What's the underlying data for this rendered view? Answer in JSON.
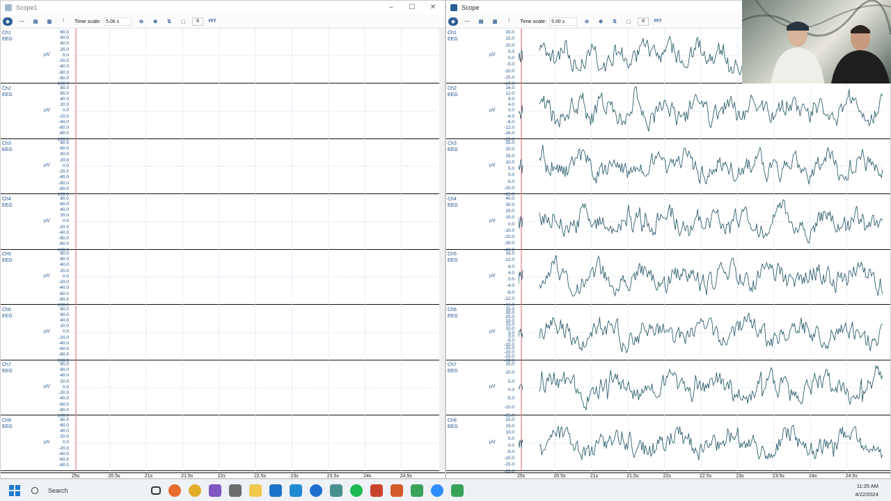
{
  "left_window": {
    "title": "Scope1",
    "toolbar": {
      "time_scale_label": "Time scale:",
      "time_scale_value": "5.00 s",
      "stepper_value": "8",
      "fft_label": "FFT"
    },
    "channels": [
      {
        "name": "Ch1",
        "type": "EEG",
        "unit": "µV",
        "ticks": [
          "80.0",
          "60.0",
          "40.0",
          "20.0",
          "0.0",
          "-20.0",
          "-40.0",
          "-60.0",
          "-80.0",
          "100.0"
        ]
      },
      {
        "name": "Ch2",
        "type": "EEG",
        "unit": "µV",
        "ticks": [
          "80.0",
          "60.0",
          "40.0",
          "20.0",
          "0.0",
          "-20.0",
          "-40.0",
          "-60.0",
          "-80.0",
          "100.0"
        ]
      },
      {
        "name": "Ch3",
        "type": "EEG",
        "unit": "µV",
        "ticks": [
          "80.0",
          "60.0",
          "40.0",
          "20.0",
          "0.0",
          "-20.0",
          "-40.0",
          "-60.0",
          "-80.0",
          "100.0"
        ]
      },
      {
        "name": "Ch4",
        "type": "EEG",
        "unit": "µV",
        "ticks": [
          "80.0",
          "60.0",
          "40.0",
          "20.0",
          "0.0",
          "-20.0",
          "-40.0",
          "-60.0",
          "-80.0",
          "100.0"
        ]
      },
      {
        "name": "Ch5",
        "type": "EEG",
        "unit": "µV",
        "ticks": [
          "80.0",
          "60.0",
          "40.0",
          "20.0",
          "0.0",
          "-20.0",
          "-40.0",
          "-60.0",
          "-80.0",
          "100.0"
        ]
      },
      {
        "name": "Ch6",
        "type": "EEG",
        "unit": "µV",
        "ticks": [
          "80.0",
          "60.0",
          "40.0",
          "20.0",
          "0.0",
          "-20.0",
          "-40.0",
          "-60.0",
          "-80.0",
          "100.0"
        ]
      },
      {
        "name": "Ch7",
        "type": "EEG",
        "unit": "µV",
        "ticks": [
          "80.0",
          "60.0",
          "40.0",
          "20.0",
          "0.0",
          "-20.0",
          "-40.0",
          "-60.0",
          "-80.0",
          "100.0"
        ]
      },
      {
        "name": "Ch8",
        "type": "EEG",
        "unit": "µV",
        "ticks": [
          "80.0",
          "60.0",
          "40.0",
          "20.0",
          "0.0",
          "-20.0",
          "-40.0",
          "-60.0",
          "-80.0",
          ""
        ]
      }
    ],
    "x_labels": [
      "25s",
      "20.5s",
      "21s",
      "21.5s",
      "22s",
      "22.5s",
      "23s",
      "23.5s",
      "24s",
      "24.5s"
    ]
  },
  "right_window": {
    "title": "Scope",
    "toolbar": {
      "time_scale_label": "Time scale:",
      "time_scale_value": "5.00 s",
      "stepper_value": "8",
      "fft_label": "FFT"
    },
    "channels": [
      {
        "name": "Ch1",
        "type": "EEG",
        "unit": "µV",
        "ticks": [
          "20.0",
          "15.0",
          "10.0",
          "5.0",
          "0.0",
          "-5.0",
          "-10.0",
          "-15.0",
          "-20.0"
        ]
      },
      {
        "name": "Ch2",
        "type": "EEG",
        "unit": "µV",
        "ticks": [
          "16.0",
          "12.0",
          "8.0",
          "4.0",
          "0.0",
          "-4.0",
          "-8.0",
          "-12.0",
          "-16.0",
          "-20.0"
        ]
      },
      {
        "name": "Ch3",
        "type": "EEG",
        "unit": "µV",
        "ticks": [
          "25.0",
          "20.0",
          "15.0",
          "10.0",
          "5.0",
          "0.0",
          "-5.0",
          "-10.0",
          "-15.0"
        ]
      },
      {
        "name": "Ch4",
        "type": "EEG",
        "unit": "µV",
        "ticks": [
          "40.0",
          "30.0",
          "20.0",
          "10.0",
          "0.0",
          "-10.0",
          "-20.0",
          "-30.0",
          "-40.0"
        ]
      },
      {
        "name": "Ch5",
        "type": "EEG",
        "unit": "µV",
        "ticks": [
          "16.0",
          "12.0",
          "8.0",
          "4.0",
          "0.0",
          "-4.0",
          "-8.0",
          "-12.0",
          "-16.0"
        ]
      },
      {
        "name": "Ch6",
        "type": "EEG",
        "unit": "µV",
        "ticks": [
          "35.0",
          "30.0",
          "25.0",
          "20.0",
          "15.0",
          "10.0",
          "5.0",
          "0.0",
          "-5.0",
          "-10.0",
          "-15.0",
          "-20.0",
          "-25.0",
          "-30.0"
        ]
      },
      {
        "name": "Ch7",
        "type": "EEG",
        "unit": "µV",
        "ticks": [
          "15.0",
          "10.0",
          "5.0",
          "0.0",
          "-5.0",
          "-10.0",
          "-15.0"
        ]
      },
      {
        "name": "Ch8",
        "type": "EEG",
        "unit": "µV",
        "ticks": [
          "20.0",
          "15.0",
          "10.0",
          "5.0",
          "0.0",
          "-5.0",
          "-10.0",
          "-15.0",
          "-20.0"
        ]
      }
    ],
    "x_labels": [
      "25s",
      "20.5s",
      "21s",
      "21.5s",
      "22s",
      "22.5s",
      "23s",
      "23.5s",
      "24s",
      "24.5s"
    ]
  },
  "taskbar": {
    "search_placeholder": "Search",
    "apps": [
      "task-view",
      "firefox",
      "chrome",
      "visual-studio",
      "package",
      "file-explorer",
      "outlook",
      "vscode",
      "app-circle",
      "app-gear",
      "spotify",
      "powerpoint",
      "app-arrow",
      "app-g",
      "zoom",
      "app-g2"
    ],
    "time": "11:25 AM",
    "date": "4/22/2024"
  },
  "colors": {
    "accent": "#1c4f8a",
    "trace": "#2f5f6e",
    "grid": "#a9c3e6",
    "marker": "#e05b6c"
  }
}
